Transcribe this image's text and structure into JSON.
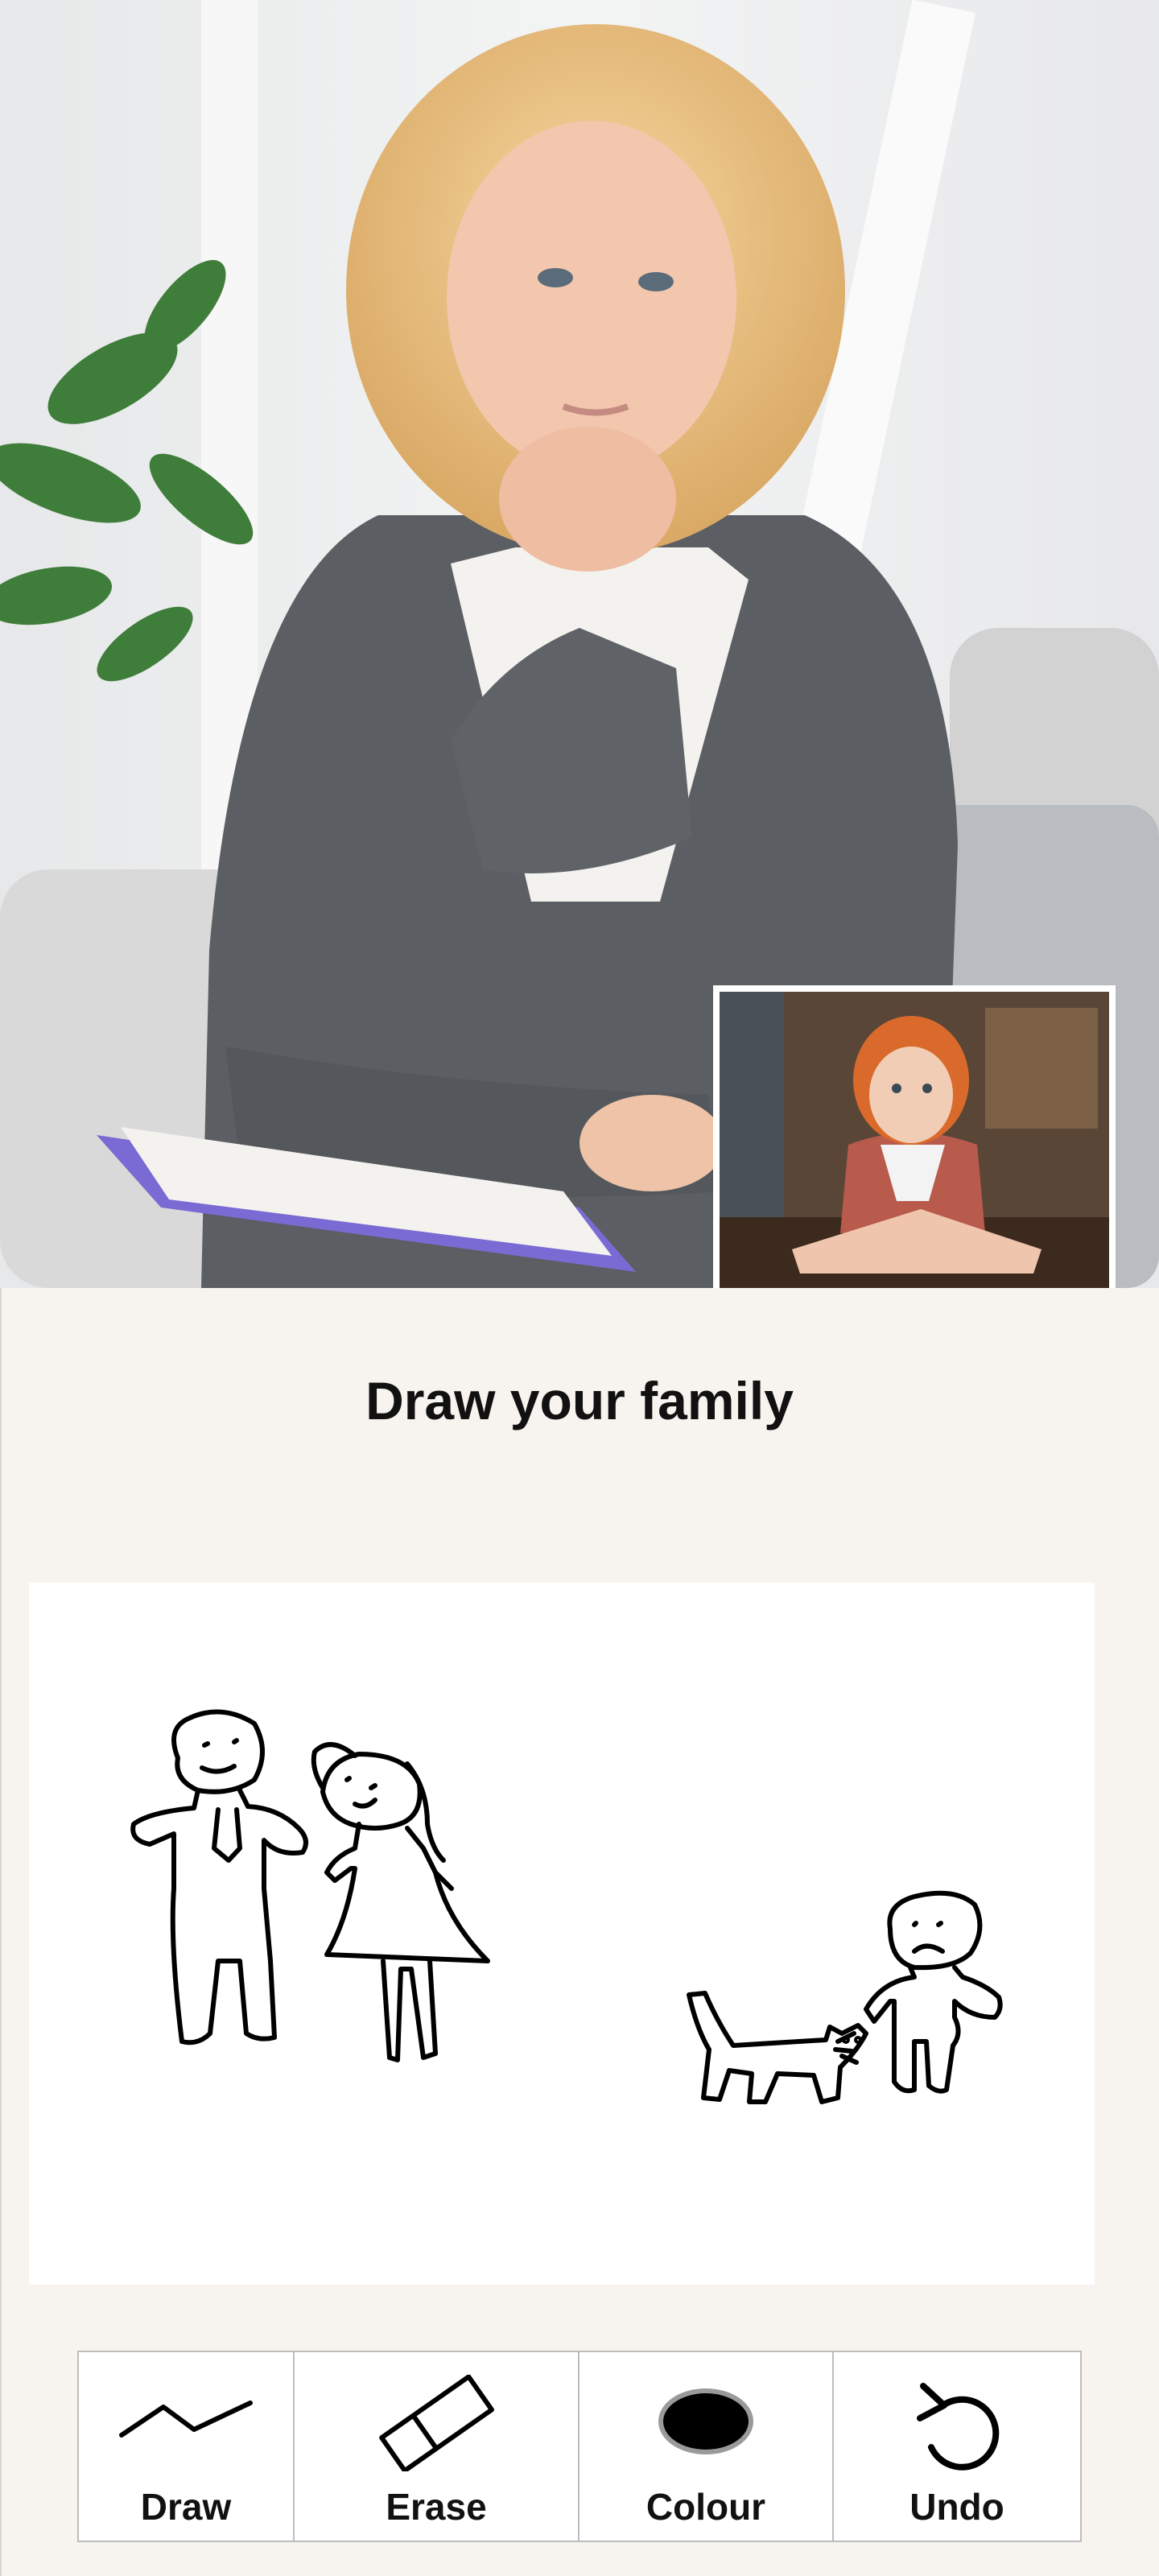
{
  "prompt": "Draw your family",
  "toolbar": {
    "items": [
      {
        "label": "Draw",
        "icon": "draw-line-icon"
      },
      {
        "label": "Erase",
        "icon": "eraser-icon"
      },
      {
        "label": "Colour",
        "icon": "colour-swatch-icon",
        "value": "#000000"
      },
      {
        "label": "Undo",
        "icon": "undo-arrow-icon"
      }
    ]
  },
  "colors": {
    "panel_background": "#f7f3ef",
    "canvas_background": "#ffffff",
    "stroke": "#000000",
    "selected_colour": "#000000"
  }
}
